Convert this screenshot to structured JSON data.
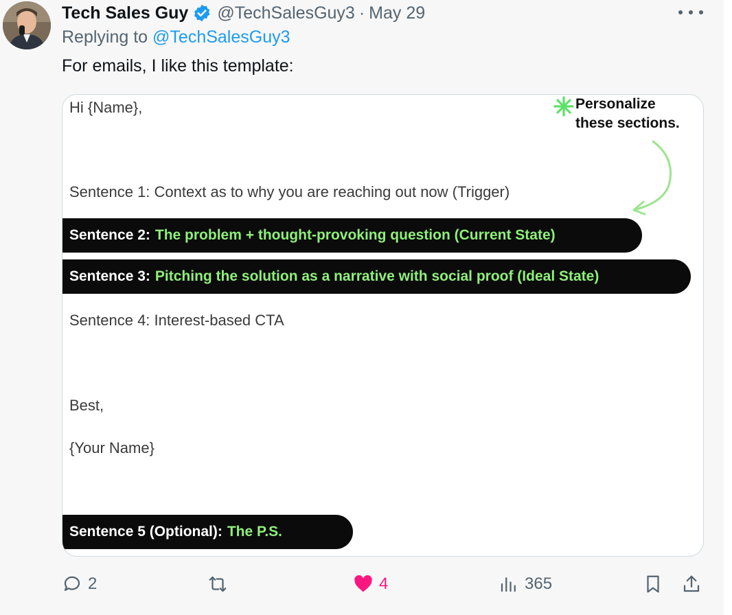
{
  "tweet": {
    "display_name": "Tech Sales Guy",
    "handle": "@TechSalesGuy3",
    "separator": "·",
    "date": "May 29",
    "reply_prefix": "Replying to",
    "reply_to": "@TechSalesGuy3",
    "text": "For emails, I like this template:"
  },
  "media": {
    "greeting": "Hi {Name},",
    "callout": [
      "Personalize",
      "these sections."
    ],
    "sentence1": "Sentence 1: Context as to why you are reaching out now (Trigger)",
    "sentence2": {
      "label": "Sentence 2:",
      "text": "The problem + thought-provoking question (Current State)"
    },
    "sentence3": {
      "label": "Sentence 3:",
      "text": "Pitching the solution as a narrative with social proof (Ideal State)"
    },
    "sentence4": "Sentence 4: Interest-based CTA",
    "signoff": "Best,",
    "signature": "{Your Name}",
    "sentence5": {
      "label": "Sentence 5 (Optional):",
      "text": "The P.S."
    }
  },
  "actions": {
    "replies": "2",
    "retweets": "",
    "likes": "4",
    "views": "365"
  },
  "colors": {
    "accent": "#1d9bf0",
    "like": "#f91880",
    "highlight_green": "#8ff07a",
    "muted": "#536471"
  },
  "icons": [
    "avatar",
    "verified-badge-icon",
    "more-icon",
    "reply-icon",
    "retweet-icon",
    "heart-icon",
    "views-icon",
    "bookmark-icon",
    "share-icon",
    "asterisk-star-icon",
    "curved-arrow-icon"
  ]
}
